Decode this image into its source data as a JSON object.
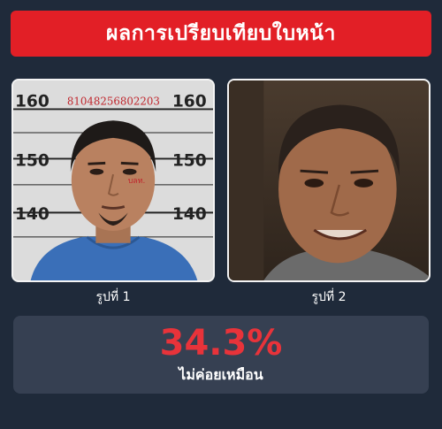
{
  "header": {
    "title": "ผลการเปรียบเทียบใบหน้า"
  },
  "photos": [
    {
      "caption": "รูปที่ 1",
      "ruler_left": [
        "160",
        "150",
        "140"
      ],
      "ruler_right": [
        "160",
        "150",
        "140"
      ],
      "stamp_number": "81048256802203",
      "stamp_mark": "บลท."
    },
    {
      "caption": "รูปที่ 2"
    }
  ],
  "result": {
    "percent": "34.3%",
    "label": "ไม่ค่อยเหมือน"
  },
  "colors": {
    "background": "#1f2a3a",
    "header": "#e21f26",
    "card": "#364052",
    "percent": "#e8333a"
  }
}
